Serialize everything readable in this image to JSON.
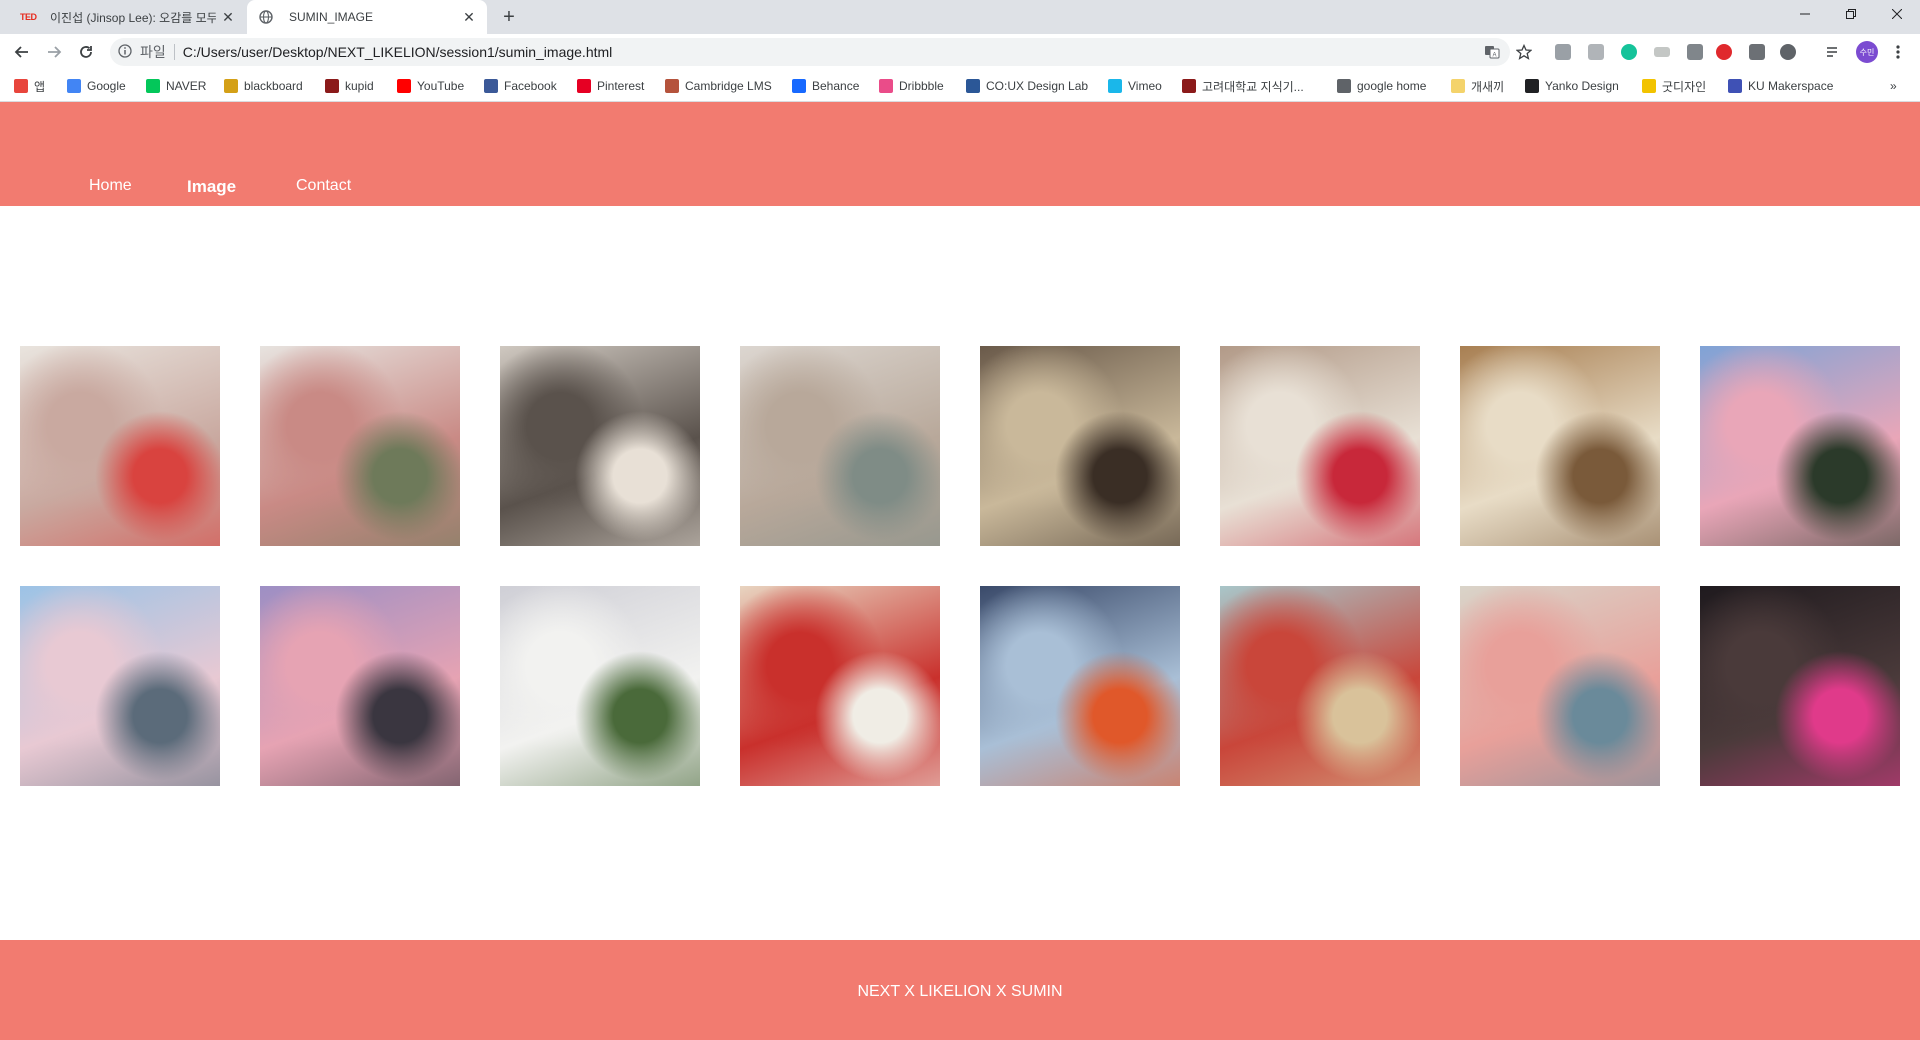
{
  "browser": {
    "tabs": [
      {
        "title": "이진섭 (Jinsop Lee): 오감를 모두",
        "favicon": "ted-logo",
        "favicon_text": "TED",
        "active": false
      },
      {
        "title": "SUMIN_IMAGE",
        "favicon": "globe-icon",
        "active": true
      }
    ],
    "address": {
      "scheme_label": "파일",
      "url": "C:/Users/user/Desktop/NEXT_LIKELION/session1/sumin_image.html"
    },
    "profile_initials": "수민",
    "bookmarks": [
      {
        "label": "앱",
        "icon": "apps-grid-icon",
        "color": "#e8453c"
      },
      {
        "label": "Google",
        "icon": "google-icon",
        "color": "#4285f4"
      },
      {
        "label": "NAVER",
        "icon": "naver-icon",
        "color": "#03c75a"
      },
      {
        "label": "blackboard",
        "icon": "blackboard-icon",
        "color": "#d4a017"
      },
      {
        "label": "kupid",
        "icon": "korea-univ-icon",
        "color": "#8b1a1a"
      },
      {
        "label": "YouTube",
        "icon": "youtube-icon",
        "color": "#ff0000"
      },
      {
        "label": "Facebook",
        "icon": "facebook-icon",
        "color": "#3b5998"
      },
      {
        "label": "Pinterest",
        "icon": "pinterest-icon",
        "color": "#e60023"
      },
      {
        "label": "Cambridge LMS",
        "icon": "cambridge-icon",
        "color": "#b5533c"
      },
      {
        "label": "Behance",
        "icon": "behance-icon",
        "color": "#1769ff"
      },
      {
        "label": "Dribbble",
        "icon": "dribbble-icon",
        "color": "#ea4c89"
      },
      {
        "label": "CO:UX Design Lab",
        "icon": "coux-icon",
        "color": "#2b5797"
      },
      {
        "label": "Vimeo",
        "icon": "vimeo-icon",
        "color": "#1ab7ea"
      },
      {
        "label": "고려대학교 지식기...",
        "icon": "korea-univ-icon",
        "color": "#8b1a1a"
      },
      {
        "label": "google home",
        "icon": "google-home-icon",
        "color": "#5f6368"
      },
      {
        "label": "개새끼",
        "icon": "folder-icon",
        "color": "#f4d36b"
      },
      {
        "label": "Yanko Design",
        "icon": "yanko-icon",
        "color": "#202124"
      },
      {
        "label": "굿디자인",
        "icon": "good-design-icon",
        "color": "#f2c300"
      },
      {
        "label": "KU Makerspace",
        "icon": "makerspace-icon",
        "color": "#3f51b5"
      }
    ]
  },
  "site": {
    "nav": {
      "home": "Home",
      "image": "Image",
      "contact": "Contact"
    },
    "gallery": [
      {
        "name": "gallery-image-room-flowers",
        "colors": [
          "#e9e4de",
          "#c9a9a0",
          "#d9433f"
        ]
      },
      {
        "name": "gallery-image-dried-flowers",
        "colors": [
          "#e7e3df",
          "#c98a85",
          "#6e7a5a"
        ]
      },
      {
        "name": "gallery-image-mirror-desk",
        "colors": [
          "#cfc8c0",
          "#5a524c",
          "#e8e0d6"
        ]
      },
      {
        "name": "gallery-image-wall-photos",
        "colors": [
          "#dcd6d0",
          "#b8a89a",
          "#7f8c86"
        ]
      },
      {
        "name": "gallery-image-round-table",
        "colors": [
          "#6a5a4a",
          "#c9b89a",
          "#3a2e25"
        ]
      },
      {
        "name": "gallery-image-berries-book",
        "colors": [
          "#b29a88",
          "#e8e0d5",
          "#c8283a"
        ]
      },
      {
        "name": "gallery-image-kitchen-dog",
        "colors": [
          "#a87f52",
          "#e8dcc6",
          "#7a5a3a"
        ]
      },
      {
        "name": "gallery-image-pink-sky-wires",
        "colors": [
          "#7fa3d6",
          "#e9a6b8",
          "#2b3a2a"
        ]
      },
      {
        "name": "gallery-image-moon-sky",
        "colors": [
          "#9cc3e6",
          "#e8c9d3",
          "#5b6b7a"
        ]
      },
      {
        "name": "gallery-image-mountain-sunset",
        "colors": [
          "#9d8fc4",
          "#e6a3b3",
          "#3a3640"
        ]
      },
      {
        "name": "gallery-image-white-rose-silk",
        "colors": [
          "#cfcfd6",
          "#f2f2f0",
          "#4a6a3a"
        ]
      },
      {
        "name": "gallery-image-retro-skirts",
        "colors": [
          "#e8d4c0",
          "#c9302c",
          "#f0ede5"
        ]
      },
      {
        "name": "gallery-image-roller-skates",
        "colors": [
          "#3a4a6a",
          "#a9bfd6",
          "#e0582a"
        ]
      },
      {
        "name": "gallery-image-vegas-signs",
        "colors": [
          "#a8c6c9",
          "#c9463a",
          "#d9c29a"
        ]
      },
      {
        "name": "gallery-image-pink-car",
        "colors": [
          "#d9d4c9",
          "#e8a09a",
          "#6a8a9a"
        ]
      },
      {
        "name": "gallery-image-night-street",
        "colors": [
          "#1f1a1e",
          "#4a3a3a",
          "#e03a8a"
        ]
      }
    ],
    "footer": "NEXT X LIKELION X SUMIN",
    "theme_color": "#f27b70"
  }
}
